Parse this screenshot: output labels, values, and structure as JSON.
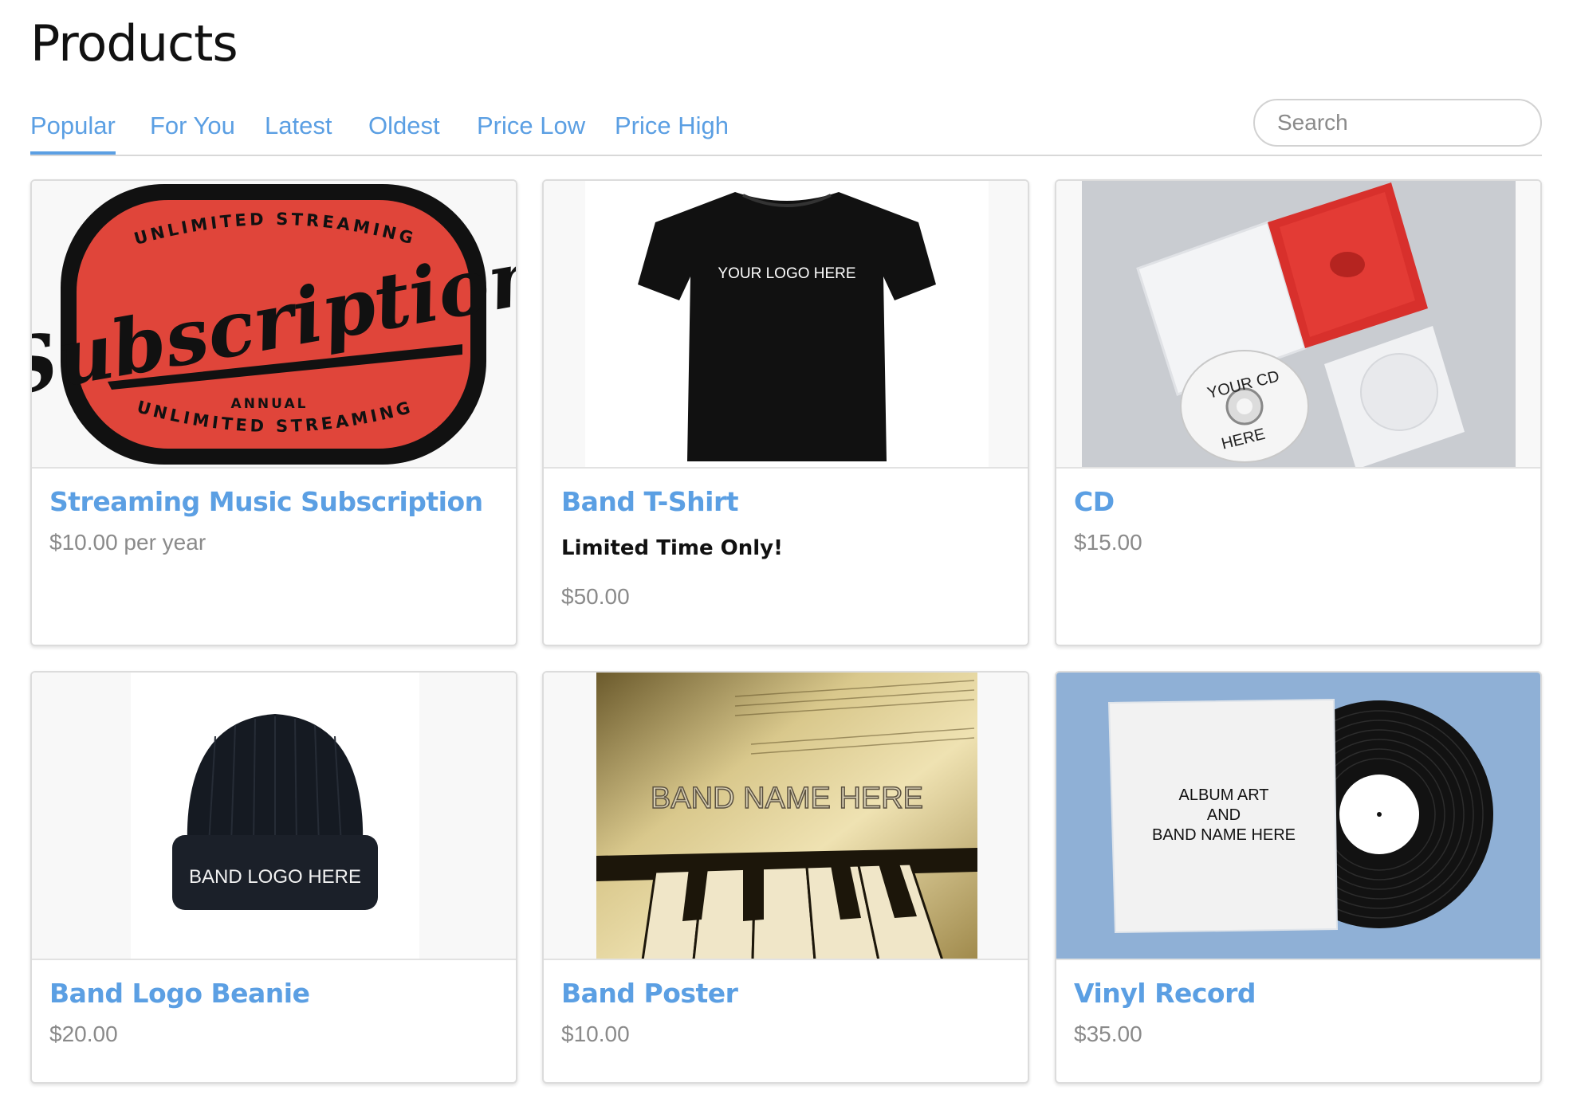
{
  "page": {
    "title": "Products"
  },
  "tabs": [
    "Popular",
    "For You",
    "Latest",
    "Oldest",
    "Price Low",
    "Price High"
  ],
  "active_tab": "Popular",
  "search": {
    "placeholder": "Search",
    "value": ""
  },
  "colors": {
    "accent": "#5b9fe3",
    "price": "#8a8a8a",
    "badge_red": "#e0453a"
  },
  "products": [
    {
      "name": "Streaming Music Subscription",
      "price": "$10.00 per year",
      "image": {
        "icon": "subscription-badge-image",
        "arc_top": "UNLIMITED STREAMING",
        "script": "Subscription",
        "caption": "ANNUAL",
        "arc_bottom": "UNLIMITED STREAMING"
      }
    },
    {
      "name": "Band T-Shirt",
      "note": "Limited Time Only!",
      "price": "$50.00",
      "image": {
        "icon": "tshirt-image",
        "text": "YOUR LOGO HERE"
      }
    },
    {
      "name": "CD",
      "price": "$15.00",
      "image": {
        "icon": "cd-case-image",
        "text_top": "YOUR CD",
        "text_bottom": "HERE"
      }
    },
    {
      "name": "Band Logo Beanie",
      "price": "$20.00",
      "image": {
        "icon": "beanie-image",
        "text": "BAND LOGO HERE"
      }
    },
    {
      "name": "Band Poster",
      "price": "$10.00",
      "image": {
        "icon": "piano-poster-image",
        "text": "BAND NAME HERE"
      }
    },
    {
      "name": "Vinyl Record",
      "price": "$35.00",
      "image": {
        "icon": "vinyl-record-image",
        "line1": "ALBUM ART",
        "line2": "AND",
        "line3": "BAND NAME HERE"
      }
    }
  ]
}
